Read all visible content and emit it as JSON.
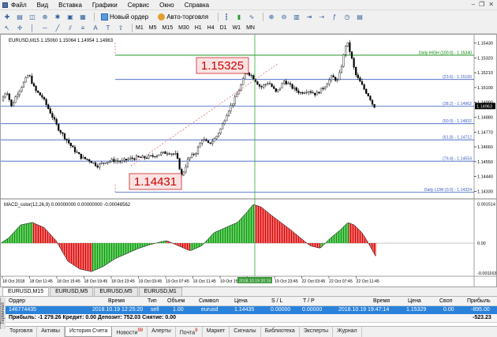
{
  "menu": {
    "items": [
      "Файл",
      "Вид",
      "Вставка",
      "Графики",
      "Сервис",
      "Окно",
      "Справка"
    ]
  },
  "toolbar": {
    "new_order_label": "Новый ордер",
    "autotrading_label": "Авто-торговля",
    "timeframes": [
      "M1",
      "M5",
      "M15",
      "M30",
      "H1",
      "H4",
      "D1",
      "W1",
      "MN"
    ]
  },
  "chart": {
    "info": "EURUSD,M15  1.15060 1.15064 1.14954 1.14963",
    "macd_info": "MACD_color(12,26,9) 0.00000000 0.00000000 -0.00048562",
    "fib_labels": [
      {
        "text": "Daily HIGH (100.0) - 1.15340",
        "price": 1.1534
      },
      {
        "text": "(23.6) - 1.15160",
        "price": 1.1516
      },
      {
        "text": "(38.2) - 1.14962",
        "price": 1.14962
      },
      {
        "text": "(50.0) - 1.14832",
        "price": 1.14832
      },
      {
        "text": "(61.8) - 1.14712",
        "price": 1.14712
      },
      {
        "text": "(76.4) - 1.14554",
        "price": 1.14554
      },
      {
        "text": "Daily LOW (0.0) - 1.14324",
        "price": 1.14324
      }
    ],
    "annotation_high": "1.15325",
    "annotation_low": "1.14431",
    "price_axis": [
      "1.15430",
      "1.15320",
      "1.15210",
      "1.15100",
      "1.14990",
      "1.14880",
      "1.14770",
      "1.14660",
      "1.14550",
      "1.14440",
      "1.14330"
    ],
    "current_price": "1.14963",
    "macd_axis": [
      "0.001514",
      "0.00",
      "-0.001163"
    ],
    "time_axis": [
      "18 Oct 2018",
      "18 Oct 11:45",
      "18 Oct 15:45",
      "18 Oct 19:45",
      "18 Oct 23:45",
      "19 Oct 03:45",
      "19 Oct 07:45",
      "19 Oct 11:45",
      "19 Oct 15:45",
      "19 Oct 19:45",
      "19 Oct 23:45",
      "22 Oct 03:45",
      "22 Oct 07:45",
      "22 Oct 11:45"
    ],
    "crosshair_time": "2018.10.19 20:15",
    "colors": {
      "bull": "#00a000",
      "bear": "#e00000",
      "fib": "#3a5ec4",
      "high_line": "#008000",
      "trend": "#e07070"
    }
  },
  "chart_tabs": [
    "EURUSD,M15",
    "EURUSD,M5",
    "EURUSD,M5",
    "EURUSD,M1"
  ],
  "terminal": {
    "side_label": "Терминал",
    "columns": [
      "Ордер",
      "Время",
      "Тип",
      "Объем",
      "Символ",
      "Цена",
      "S / L",
      "T / P",
      "Время",
      "Цена",
      "Своп",
      "Прибыль"
    ],
    "row": [
      "146774435",
      "2018.10.19 12:25:20",
      "sell",
      "1.00",
      "eurusd",
      "1.14435",
      "0.00000",
      "0.00000",
      "2018.10.19 19:47:14",
      "1.15329",
      "0.00",
      "-895.00"
    ],
    "summary": "Прибыль: -1 279.26  Кредит: 0.00  Депозит: 752.03  Снятие: 0.00",
    "summary_total": "-523.23"
  },
  "bottom_tabs": [
    {
      "label": "Торговля",
      "badge": ""
    },
    {
      "label": "Активы",
      "badge": ""
    },
    {
      "label": "История Счета",
      "badge": ""
    },
    {
      "label": "Новости",
      "badge": "99"
    },
    {
      "label": "Алерты",
      "badge": ""
    },
    {
      "label": "Почта",
      "badge": "8"
    },
    {
      "label": "Маркет",
      "badge": ""
    },
    {
      "label": "Сигналы",
      "badge": ""
    },
    {
      "label": "Библиотека",
      "badge": ""
    },
    {
      "label": "Эксперты",
      "badge": ""
    },
    {
      "label": "Журнал",
      "badge": ""
    }
  ]
}
